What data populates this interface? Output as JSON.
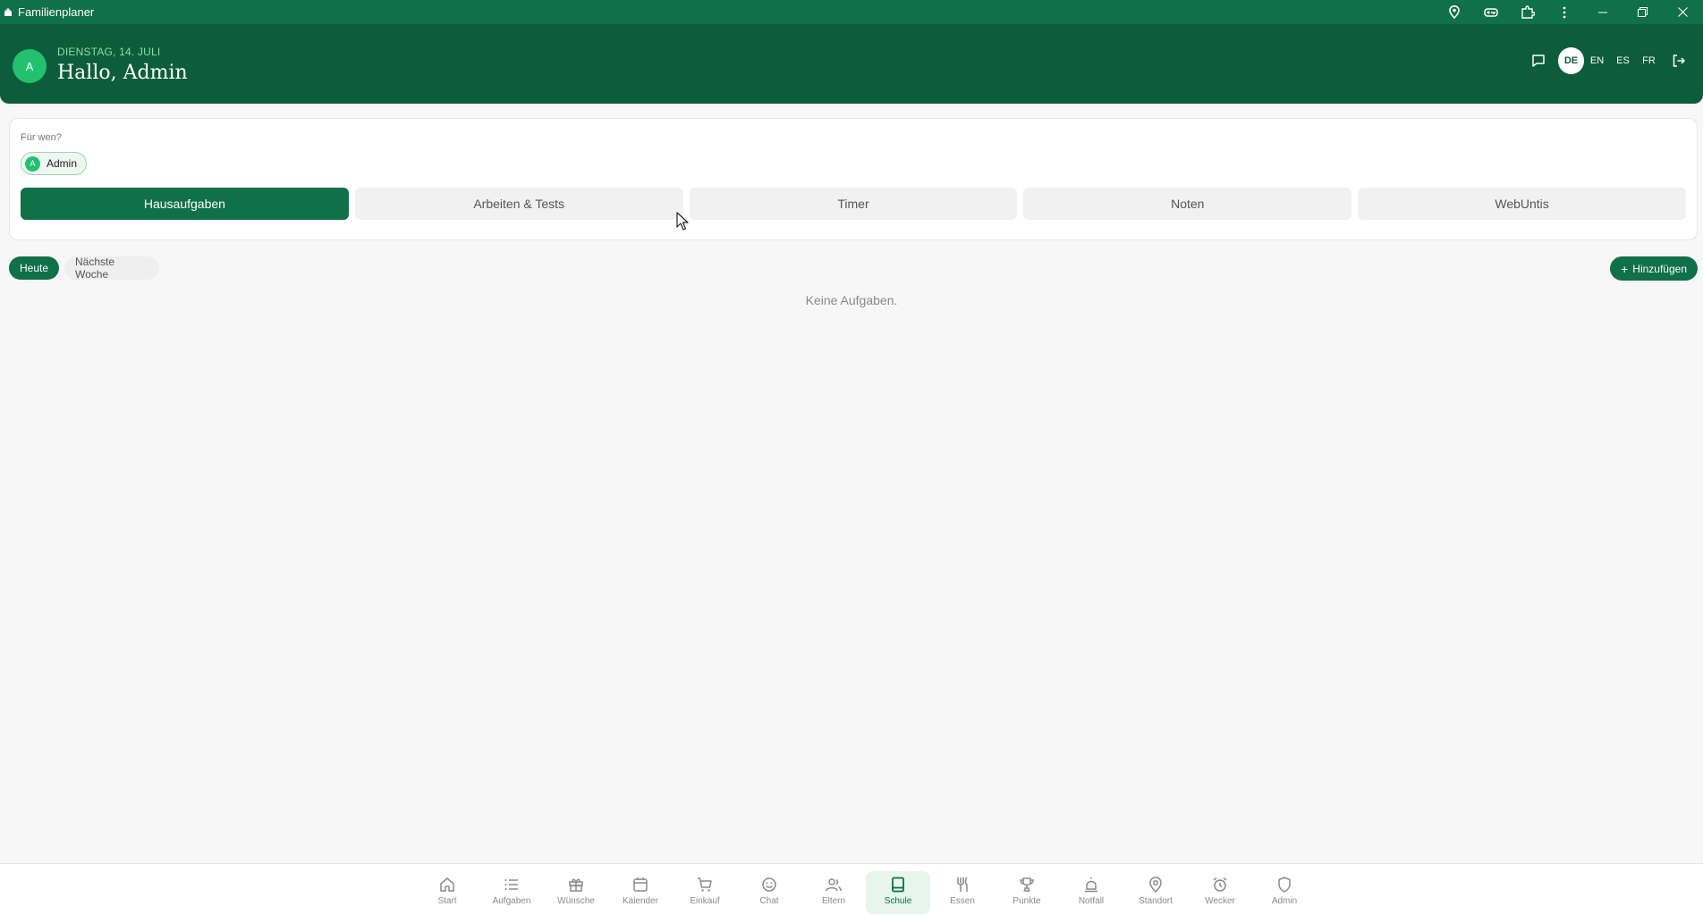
{
  "window": {
    "title": "Familienplaner"
  },
  "header": {
    "avatar_initial": "A",
    "date": "DIENSTAG, 14. JULI",
    "greeting": "Hallo, Admin",
    "languages": [
      {
        "code": "DE",
        "active": true
      },
      {
        "code": "EN",
        "active": false
      },
      {
        "code": "ES",
        "active": false
      },
      {
        "code": "FR",
        "active": false
      }
    ]
  },
  "card": {
    "for_label": "Für wen?",
    "person": {
      "initial": "A",
      "name": "Admin"
    },
    "tabs": [
      {
        "label": "Hausaufgaben",
        "active": true
      },
      {
        "label": "Arbeiten & Tests",
        "active": false
      },
      {
        "label": "Timer",
        "active": false
      },
      {
        "label": "Noten",
        "active": false
      },
      {
        "label": "WebUntis",
        "active": false
      }
    ]
  },
  "filters": {
    "today": "Heute",
    "next_week": "Nächste Woche"
  },
  "add_button": {
    "label": "Hinzufügen",
    "icon": "plus-icon"
  },
  "empty_message": "Keine Aufgaben.",
  "nav": [
    {
      "label": "Start",
      "icon": "home-icon"
    },
    {
      "label": "Aufgaben",
      "icon": "list-icon"
    },
    {
      "label": "Wünsche",
      "icon": "gift-icon"
    },
    {
      "label": "Kalender",
      "icon": "calendar-icon"
    },
    {
      "label": "Einkauf",
      "icon": "cart-icon"
    },
    {
      "label": "Chat",
      "icon": "smiley-icon"
    },
    {
      "label": "Eltern",
      "icon": "users-icon"
    },
    {
      "label": "Schule",
      "icon": "book-icon",
      "active": true
    },
    {
      "label": "Essen",
      "icon": "utensils-icon"
    },
    {
      "label": "Punkte",
      "icon": "trophy-icon"
    },
    {
      "label": "Notfall",
      "icon": "alert-icon"
    },
    {
      "label": "Standort",
      "icon": "location-icon"
    },
    {
      "label": "Wecker",
      "icon": "alarm-icon"
    },
    {
      "label": "Admin",
      "icon": "shield-icon"
    }
  ],
  "colors": {
    "primary": "#0f7049",
    "header": "#0c5d3a",
    "accent": "#22c170"
  }
}
